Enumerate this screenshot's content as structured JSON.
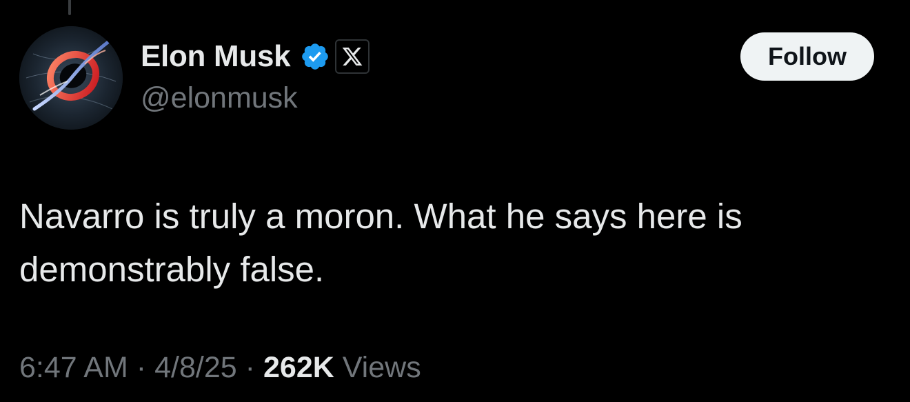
{
  "author": {
    "display_name": "Elon Musk",
    "handle": "@elonmusk",
    "verified_icon": "verified-badge-icon",
    "affiliate_icon": "x-logo-icon",
    "avatar_icon": "black-hole-avatar"
  },
  "actions": {
    "follow_label": "Follow"
  },
  "tweet": {
    "text": "Navarro is truly a moron. What he says here is demonstrably false."
  },
  "meta": {
    "time": "6:47 AM",
    "separator": "·",
    "date": "4/8/25",
    "views_count": "262K",
    "views_label": "Views"
  },
  "colors": {
    "background": "#000000",
    "primary_text": "#e7e9ea",
    "secondary_text": "#71767b",
    "verified_blue": "#1d9bf0",
    "follow_button_bg": "#eff3f4",
    "follow_button_text": "#0f1419"
  }
}
